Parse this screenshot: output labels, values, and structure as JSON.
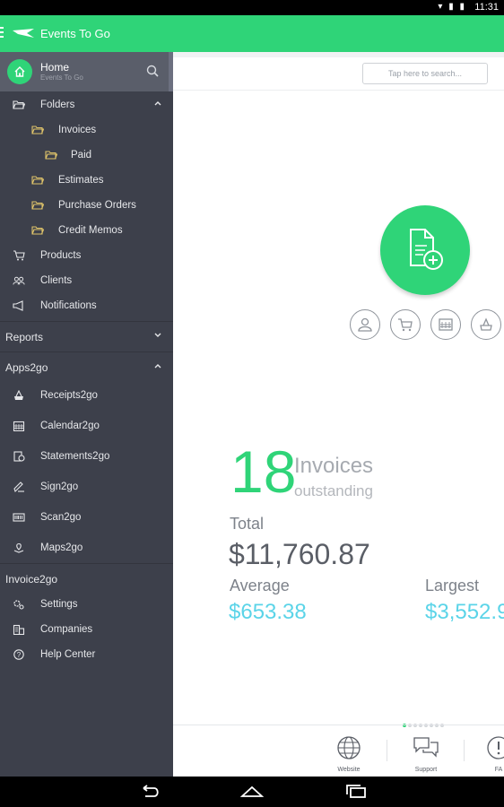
{
  "status": {
    "time": "11:31"
  },
  "appbar": {
    "title": "Events To Go"
  },
  "sidebar": {
    "home": {
      "label": "Home",
      "sub": "Events To Go"
    },
    "folders": {
      "label": "Folders",
      "items": [
        "Invoices",
        "Paid",
        "Estimates",
        "Purchase Orders",
        "Credit Memos"
      ]
    },
    "products": "Products",
    "clients": "Clients",
    "notifications": "Notifications",
    "reports": "Reports",
    "apps2go": {
      "label": "Apps2go",
      "items": [
        "Receipts2go",
        "Calendar2go",
        "Statements2go",
        "Sign2go",
        "Scan2go",
        "Maps2go"
      ]
    },
    "invoice2go": {
      "label": "Invoice2go",
      "items": [
        "Settings",
        "Companies",
        "Help Center"
      ]
    }
  },
  "main": {
    "search_placeholder": "Tap here to search...",
    "count": "18",
    "count_label": "Invoices",
    "count_sub": "outstanding",
    "total_label": "Total",
    "total_value": "$11,760.87",
    "average_label": "Average",
    "average_value": "$653.38",
    "largest_label": "Largest",
    "largest_value": "$3,552.9",
    "bottom": {
      "website": "Website",
      "support": "Support",
      "faq": "FA"
    }
  },
  "colors": {
    "accent": "#2fd478",
    "sidebar": "#3d404b",
    "value": "#5bd4e8"
  }
}
